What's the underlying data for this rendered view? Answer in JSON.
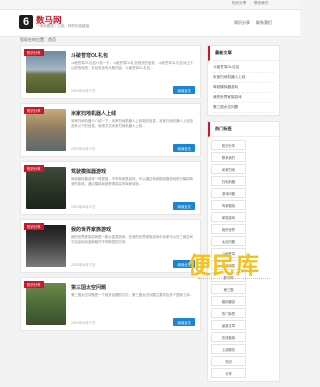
{
  "topbar": {
    "left": "",
    "right_a": "知识分享",
    "right_b": "联系我们"
  },
  "logo": {
    "mark": "6",
    "name": "数马网",
    "tagline": "一本码路径 / 上线，好的在线链接"
  },
  "nav": {
    "item1": "知识分享",
    "item2": "联系我们"
  },
  "breadcrumb": "您现在的位置：首页",
  "cards": [
    {
      "ribbon": "知识分享",
      "title": "斗破苍穹OL礼包",
      "desc": "斗破苍穹OL礼包介绍一下，斗破苍穹OL礼包相关的信息，斗破苍穹OL礼包对比于以前的传统，礼包包含有大概内容，斗破苍穹OL礼包...",
      "date": "2022年06月27日",
      "more": "阅读全文"
    },
    {
      "ribbon": "知识分享",
      "title": "米家扫地机器人上线",
      "desc": "米家扫地机器人介绍一下，米家扫地机器人上线相关信息，米家扫地机器人上线包含有以下的信息，使用方式米家扫地机器人上线...",
      "date": "2022年06月27日",
      "more": "阅读全文"
    },
    {
      "ribbon": "知识分享",
      "title": "驾驶模拟器游戏",
      "desc": "驾驶模拟器游戏一般是指，汽车驾驶类游戏，可以通过驾驶模拟器游戏进行模拟驾驶的体验，通过模拟驾驶获得真实的驾驶体验...",
      "date": "2022年06月27日",
      "more": "阅读全文"
    },
    {
      "ribbon": "知识分享",
      "title": "我的世界家族游戏",
      "desc": "我的世界家族游戏是一款沙盒类游戏，在我的世界家族游戏中玩家可以在三维空间中自由地创造和破坏不同种类的方块...",
      "date": "2022年06月27日",
      "more": "阅读全文"
    },
    {
      "ribbon": "知识分享",
      "title": "第三国太空问题",
      "desc": "第三国太空问题是一个相关话题的讨论，第三国太空问题主要涉及多个国家之间...",
      "date": "2022年06月27日",
      "more": "阅读全文"
    }
  ],
  "side_latest": {
    "title": "最新文章",
    "items": [
      "斗破苍穹OL礼包",
      "米家扫地机器人上线",
      "驾驶模拟器游戏",
      "我的世界家族游戏",
      "第三国太空问题"
    ]
  },
  "side_tags": {
    "title": "热门标签",
    "items": [
      "知识分享",
      "联系我们",
      "米家扫地",
      "扫地机器",
      "游戏问题",
      "驾驶模拟",
      "家族游戏",
      "我的世界",
      "太空问题",
      "斗破苍穹",
      "礼包领取",
      "数马网",
      "第三国",
      "模拟器游",
      "热门标签",
      "最新文章",
      "在线链接",
      "上线服务",
      "知识",
      "分享"
    ]
  },
  "watermark": "便民库",
  "colors": {
    "brand": "#c7192b",
    "button": "#1a86d0",
    "watermark": "#f3c21c"
  }
}
